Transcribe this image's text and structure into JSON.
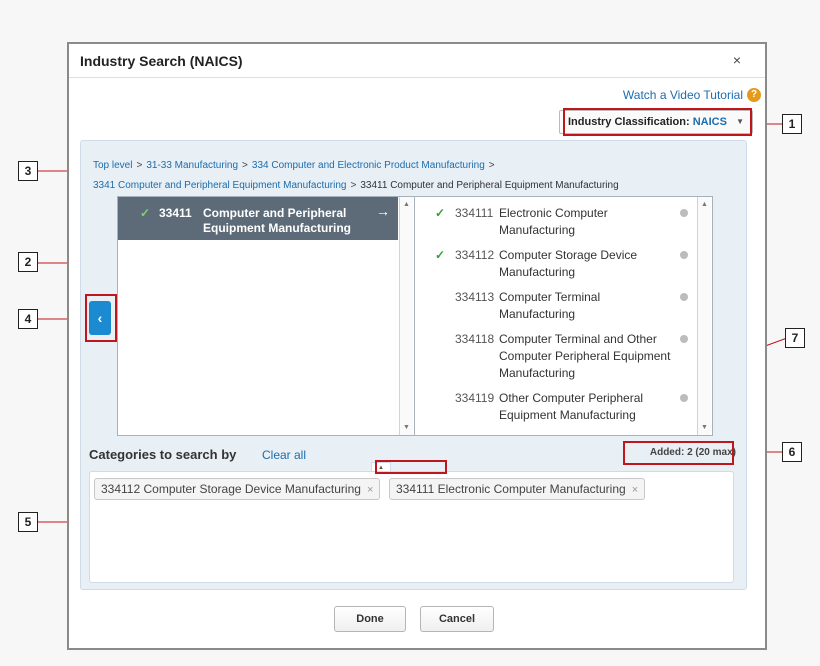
{
  "dialog": {
    "title": "Industry Search (NAICS)",
    "close_label": "×",
    "watch_tutorial": "Watch a Video Tutorial",
    "help_glyph": "?",
    "industry_label": "Industry Classification:",
    "industry_value": "NAICS"
  },
  "breadcrumb": {
    "items": [
      "Top level",
      "31-33 Manufacturing",
      "334 Computer and Electronic Product Manufacturing",
      "3341 Computer and Peripheral Equipment Manufacturing",
      "33411 Computer and Peripheral Equipment Manufacturing"
    ],
    "separator": ">"
  },
  "left_column": {
    "selected": {
      "code": "33411",
      "name": "Computer and Peripheral Equipment Manufacturing"
    }
  },
  "right_column": {
    "items": [
      {
        "code": "334111",
        "name": "Electronic Computer Manufacturing",
        "checked": true
      },
      {
        "code": "334112",
        "name": "Computer Storage Device Manufacturing",
        "checked": true
      },
      {
        "code": "334113",
        "name": "Computer Terminal Manufacturing",
        "checked": false
      },
      {
        "code": "334118",
        "name": "Computer Terminal and Other Computer Peripheral Equipment Manufacturing",
        "checked": false
      },
      {
        "code": "334119",
        "name": "Other Computer Peripheral Equipment Manufacturing",
        "checked": false
      }
    ]
  },
  "categories": {
    "title": "Categories to search by",
    "clear_all": "Clear all",
    "added_label": "Added: 2 (20 max)",
    "pills": [
      {
        "text": "334112 Computer Storage Device Manufacturing"
      },
      {
        "text": "334111 Electronic Computer Manufacturing"
      }
    ],
    "remove_glyph": "×"
  },
  "footer": {
    "done": "Done",
    "cancel": "Cancel"
  },
  "callouts": [
    "1",
    "2",
    "3",
    "4",
    "5",
    "6",
    "7"
  ],
  "colors": {
    "accent": "#1b8ad0",
    "link": "#1b6dae",
    "highlight": "#c0151b",
    "selected_row": "#5d6b79"
  }
}
